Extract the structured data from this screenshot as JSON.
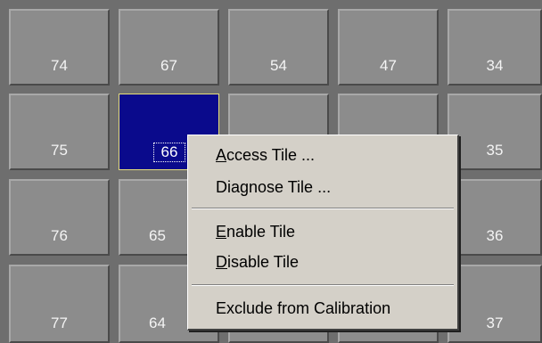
{
  "tiles": [
    {
      "id": "74"
    },
    {
      "id": "67"
    },
    {
      "id": "54"
    },
    {
      "id": "47"
    },
    {
      "id": "34"
    },
    {
      "id": "75"
    },
    {
      "id": "66",
      "selected": true
    },
    {
      "id": ""
    },
    {
      "id": ""
    },
    {
      "id": "35"
    },
    {
      "id": "76"
    },
    {
      "id": "65"
    },
    {
      "id": ""
    },
    {
      "id": ""
    },
    {
      "id": "36"
    },
    {
      "id": "77"
    },
    {
      "id": "64"
    },
    {
      "id": ""
    },
    {
      "id": ""
    },
    {
      "id": "37"
    }
  ],
  "context_menu": {
    "access_tile": {
      "hotkey": "A",
      "rest": "ccess Tile ..."
    },
    "diagnose_tile": {
      "label": "Diagnose Tile ..."
    },
    "enable_tile": {
      "hotkey": "E",
      "rest": "nable Tile"
    },
    "disable_tile": {
      "hotkey": "D",
      "rest": "isable Tile"
    },
    "exclude_from_calibration": {
      "label": "Exclude from Calibration"
    }
  },
  "colors": {
    "background": "#6e6e6e",
    "tile": "#8c8c8c",
    "selected_tile": "#0a0a8c",
    "selected_border": "#e8e07a",
    "menu": "#d4d0c8"
  }
}
